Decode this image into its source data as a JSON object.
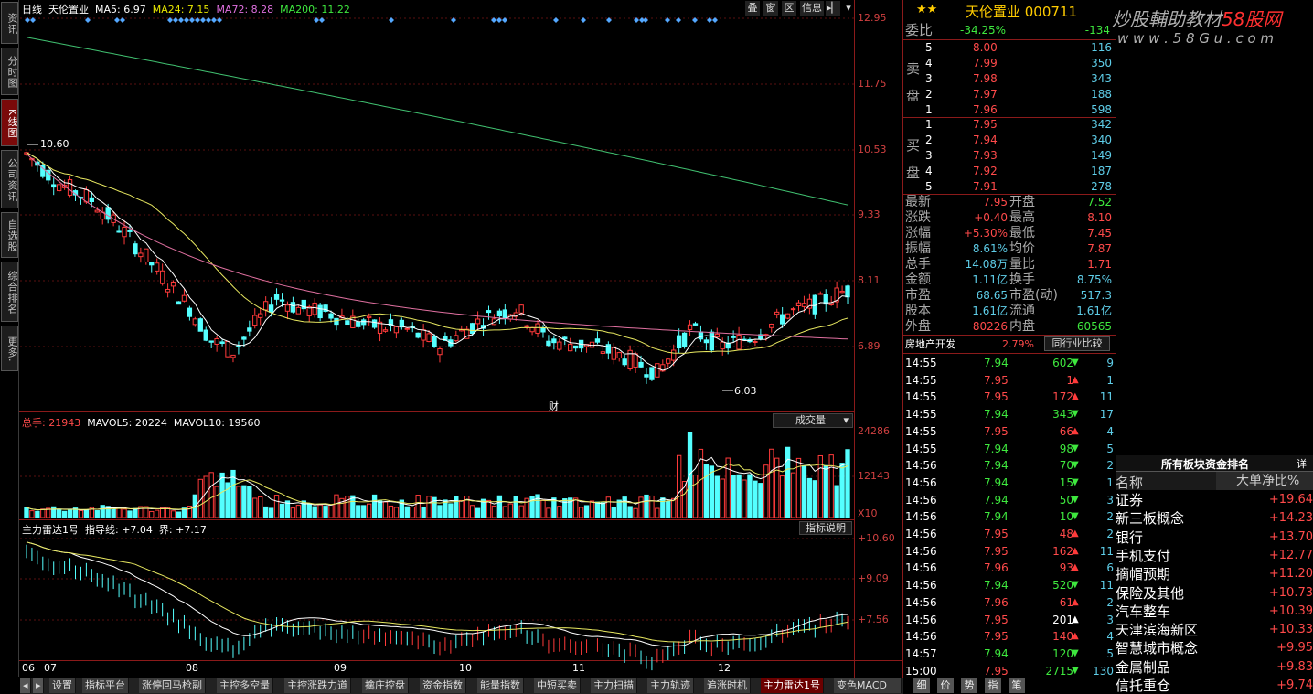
{
  "left_nav": [
    "资讯",
    "分时图",
    "K线图",
    "公司资讯",
    "自选股",
    "综合排名",
    "更多."
  ],
  "main_header": {
    "period": "日线",
    "name": "天伦置业",
    "ma5": "MA5: 6.97",
    "ma24": "MA24: 7.15",
    "ma72": "MA72: 8.28",
    "ma200": "MA200: 11.22"
  },
  "toolbar": [
    "叠",
    "窗",
    "区",
    "信息"
  ],
  "price_axis": [
    "12.95",
    "11.75",
    "10.53",
    "9.33",
    "8.11",
    "6.89"
  ],
  "annot_high": "10.60",
  "annot_low": "6.03",
  "annot_cai": "财",
  "vol_header": {
    "label": "总手: ",
    "value": "21943",
    "mavol5": "MAVOL5: 20224",
    "mavol10": "MAVOL10: 19560",
    "select": "成交量"
  },
  "vol_axis": [
    "24286",
    "12143",
    "X10"
  ],
  "ind_header": {
    "name": "主力雷达1号",
    "line1": "指导线: +7.04",
    "line2": "界: +7.17",
    "btn": "指标说明"
  },
  "ind_axis": [
    "+10.60",
    "+9.09",
    "+7.56"
  ],
  "x_axis": [
    "06",
    "07",
    "08",
    "09",
    "10",
    "11",
    "12"
  ],
  "bottom_tabs": [
    "设置",
    "指标平台",
    "涨停回马枪副",
    "主控多空量",
    "主控涨跌力道",
    "擒庄控盘",
    "资金指数",
    "能量指数",
    "中短买卖",
    "主力扫描",
    "主力轨迹",
    "追涨时机",
    "主力雷达1号",
    "变色MACD"
  ],
  "bottom_right_tabs": [
    "细",
    "价",
    "势",
    "指",
    "笔"
  ],
  "quote": {
    "stars": "★★",
    "title": "天伦置业 000711",
    "weibi_label": "委比",
    "weibi_pct": "-34.25%",
    "weibi_diff": "-134",
    "sell_label": [
      "卖",
      "盘"
    ],
    "buy_label": [
      "买",
      "盘"
    ],
    "sells": [
      {
        "n": "5",
        "p": "8.00",
        "v": "116"
      },
      {
        "n": "4",
        "p": "7.99",
        "v": "350"
      },
      {
        "n": "3",
        "p": "7.98",
        "v": "343"
      },
      {
        "n": "2",
        "p": "7.97",
        "v": "188"
      },
      {
        "n": "1",
        "p": "7.96",
        "v": "598"
      }
    ],
    "buys": [
      {
        "n": "1",
        "p": "7.95",
        "v": "342"
      },
      {
        "n": "2",
        "p": "7.94",
        "v": "340"
      },
      {
        "n": "3",
        "p": "7.93",
        "v": "149"
      },
      {
        "n": "4",
        "p": "7.92",
        "v": "187"
      },
      {
        "n": "5",
        "p": "7.91",
        "v": "278"
      }
    ],
    "stats": [
      [
        "最新",
        "7.95",
        "开盘",
        "7.52"
      ],
      [
        "涨跌",
        "+0.40",
        "最高",
        "8.10"
      ],
      [
        "涨幅",
        "+5.30%",
        "最低",
        "7.45"
      ],
      [
        "振幅",
        "8.61%",
        "均价",
        "7.87"
      ],
      [
        "总手",
        "14.08万",
        "量比",
        "1.71"
      ],
      [
        "金额",
        "1.11亿",
        "换手",
        "8.75%"
      ],
      [
        "市盈",
        "68.65",
        "市盈(动)",
        "517.3"
      ],
      [
        "股本",
        "1.61亿",
        "流通",
        "1.61亿"
      ],
      [
        "外盘",
        "80226",
        "内盘",
        "60565"
      ]
    ],
    "industry": "房地产开发",
    "industry_pct": "2.79%",
    "industry_btn": "同行业比较"
  },
  "ticks": [
    [
      "14:55",
      "7.94",
      "602",
      "down",
      "9"
    ],
    [
      "14:55",
      "7.95",
      "1",
      "up",
      "1"
    ],
    [
      "14:55",
      "7.95",
      "172",
      "up",
      "11"
    ],
    [
      "14:55",
      "7.94",
      "343",
      "down",
      "17"
    ],
    [
      "14:55",
      "7.95",
      "66",
      "up",
      "4"
    ],
    [
      "14:55",
      "7.94",
      "98",
      "down",
      "5"
    ],
    [
      "14:56",
      "7.94",
      "70",
      "down",
      "2"
    ],
    [
      "14:56",
      "7.94",
      "15",
      "down",
      "1"
    ],
    [
      "14:56",
      "7.94",
      "50",
      "down",
      "3"
    ],
    [
      "14:56",
      "7.94",
      "10",
      "down",
      "2"
    ],
    [
      "14:56",
      "7.95",
      "48",
      "up",
      "2"
    ],
    [
      "14:56",
      "7.95",
      "162",
      "up",
      "11"
    ],
    [
      "14:56",
      "7.96",
      "93",
      "up",
      "6"
    ],
    [
      "14:56",
      "7.94",
      "520",
      "down",
      "11"
    ],
    [
      "14:56",
      "7.96",
      "61",
      "up",
      "2"
    ],
    [
      "14:56",
      "7.95",
      "201",
      "neutral",
      "3"
    ],
    [
      "14:56",
      "7.95",
      "140",
      "up",
      "4"
    ],
    [
      "14:57",
      "7.94",
      "120",
      "down",
      "5"
    ],
    [
      "15:00",
      "7.95",
      "2715",
      "down",
      "130"
    ]
  ],
  "watermark": {
    "line1": "炒股輔助教材",
    "line1b": "58股网",
    "line2": "w w w . 5 8 G u . c o m"
  },
  "sector": {
    "title": "所有板块资金排名",
    "detail": "详",
    "col1": "名称",
    "col2": "大单净比%",
    "rows": [
      [
        "证券",
        "+19.64"
      ],
      [
        "新三板概念",
        "+14.23"
      ],
      [
        "银行",
        "+13.70"
      ],
      [
        "手机支付",
        "+12.77"
      ],
      [
        "摘帽预期",
        "+11.20"
      ],
      [
        "保险及其他",
        "+10.73"
      ],
      [
        "汽车整车",
        "+10.39"
      ],
      [
        "天津滨海新区",
        "+10.33"
      ],
      [
        "智慧城市概念",
        "+9.95"
      ],
      [
        "金属制品",
        "+9.83"
      ],
      [
        "信托重仓",
        "+9.74"
      ]
    ]
  },
  "colors": {
    "up": "#ff3a3a",
    "down": "#54ffff",
    "ma5": "#ffffff",
    "ma24": "#e8e860",
    "ma72": "#e070a0",
    "ma200": "#40c070"
  }
}
